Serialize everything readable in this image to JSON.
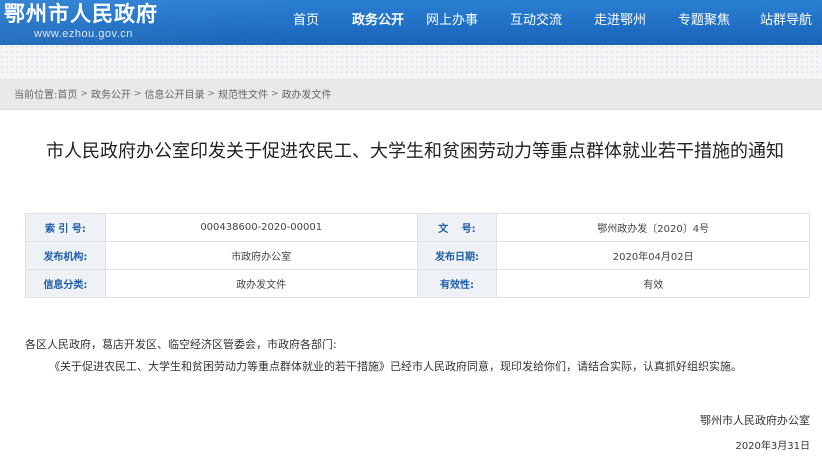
{
  "site": {
    "title": "鄂州市人民政府",
    "url": "www.ezhou.gov.cn"
  },
  "nav": [
    {
      "label": "首页",
      "active": false
    },
    {
      "label": "政务公开",
      "active": true
    },
    {
      "label": "网上办事",
      "active": false
    },
    {
      "label": "互动交流",
      "active": false
    },
    {
      "label": "走进鄂州",
      "active": false
    },
    {
      "label": "专题聚焦",
      "active": false
    },
    {
      "label": "站群导航",
      "active": false
    }
  ],
  "breadcrumb": {
    "prefix": "当前位置:",
    "items": [
      "首页",
      "政务公开",
      "信息公开目录",
      "规范性文件",
      "政办发文件"
    ]
  },
  "doc": {
    "title": "市人民政府办公室印发关于促进农民工、大学生和贫困劳动力等重点群体就业若干措施的通知",
    "info": {
      "index_label": "索 引 号:",
      "index_value": "000438600-2020-00001",
      "docno_label": "文　 号:",
      "docno_value": "鄂州政办发〔2020〕4号",
      "org_label": "发布机构:",
      "org_value": "市政府办公室",
      "date_label": "发布日期:",
      "date_value": "2020年04月02日",
      "category_label": "信息分类:",
      "category_value": "政办发文件",
      "validity_label": "有效性:",
      "validity_value": "有效"
    },
    "salutation": "各区人民政府，葛店开发区、临空经济区管委会，市政府各部门:",
    "paragraph": "《关于促进农民工、大学生和贫困劳动力等重点群体就业的若干措施》已经市人民政府同意，现印发给你们，请结合实际，认真抓好组织实施。",
    "sign_org": "鄂州市人民政府办公室",
    "sign_date": "2020年3月31日"
  },
  "colors": {
    "header_blue": "#1f6fc4",
    "label_blue": "#1f5fa8"
  }
}
